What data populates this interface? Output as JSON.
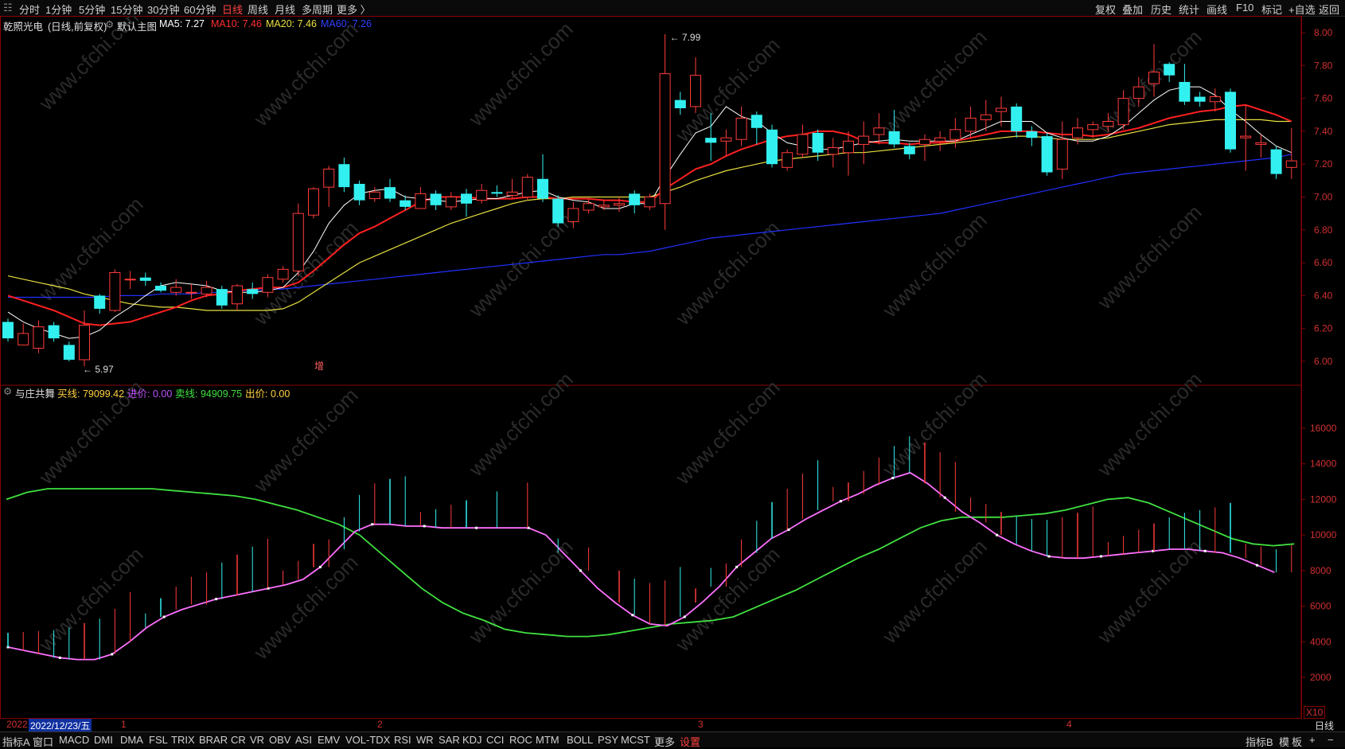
{
  "topbar": {
    "left_icon": "menu-icon",
    "periods": [
      "分时",
      "1分钟",
      "5分钟",
      "15分钟",
      "30分钟",
      "60分钟",
      "日线",
      "周线",
      "月线",
      "多周期",
      "更多 〉"
    ],
    "active_period": "日线",
    "right": [
      "复权",
      "叠加",
      "历史",
      "统计",
      "画线",
      "F10",
      "标记",
      "+自选",
      "返回"
    ]
  },
  "info": {
    "stock": "乾照光电",
    "mode": "(日线,前复权)",
    "main_label": "默认主图",
    "ma5": "MA5: 7.27",
    "ma10": "MA10: 7.46",
    "ma20": "MA20: 7.46",
    "ma60": "MA60: 7.26"
  },
  "sub_info": {
    "name": "与庄共舞",
    "buy": "买线: 79099.42",
    "in": "进价: 0.00",
    "sell": "卖线: 94909.75",
    "out": "出价: 0.00"
  },
  "annotations": {
    "high": "7.99",
    "low": "5.97",
    "marker": "增"
  },
  "price_axis": [
    "8.00",
    "7.80",
    "7.60",
    "7.40",
    "7.20",
    "7.00",
    "6.80",
    "6.60",
    "6.40",
    "6.20",
    "6.00"
  ],
  "ind_axis": [
    "16000",
    "14000",
    "12000",
    "10000",
    "8000",
    "6000",
    "4000",
    "2000"
  ],
  "ind_multiplier": "X10",
  "datebar": {
    "year": "2022",
    "cursor_date": "2022/12/23/五",
    "months": [
      "1",
      "2",
      "3",
      "4"
    ]
  },
  "bottom_tabs": [
    "指标A",
    "窗口",
    "MACD",
    "DMI",
    "DMA",
    "FSL",
    "TRIX",
    "BRAR",
    "CR",
    "VR",
    "OBV",
    "ASI",
    "EMV",
    "VOL-TDX",
    "RSI",
    "WR",
    "SAR",
    "KDJ",
    "CCI",
    "ROC",
    "MTM",
    "BOLL",
    "PSY",
    "MCST",
    "更多",
    "设置"
  ],
  "bottom_right": [
    "指标B",
    "模",
    "板",
    "+",
    "−"
  ],
  "period_right": "日线",
  "watermark": "www.cfchi.com",
  "colors": {
    "up": "#ff3b3b",
    "down": "#33f0f0",
    "ma5": "#ffffff",
    "ma10": "#ff2020",
    "ma20": "#e8e040",
    "ma60": "#2030ff",
    "buyline": "#ff70ff",
    "sellline": "#40e040",
    "grid": "#8a0000"
  },
  "chart_data": {
    "type": "candlestick",
    "price_range": [
      5.9,
      8.05
    ],
    "indicator_range": [
      0,
      17500
    ],
    "candles": [
      [
        6.24,
        6.14,
        6.26,
        6.12
      ],
      [
        6.1,
        6.17,
        6.23,
        6.1
      ],
      [
        6.08,
        6.21,
        6.25,
        6.05
      ],
      [
        6.22,
        6.14,
        6.24,
        6.12
      ],
      [
        6.1,
        6.01,
        6.12,
        6.0
      ],
      [
        6.01,
        6.22,
        6.31,
        5.97
      ],
      [
        6.4,
        6.32,
        6.41,
        6.29
      ],
      [
        6.31,
        6.54,
        6.56,
        6.3
      ],
      [
        6.5,
        6.5,
        6.55,
        6.44
      ],
      [
        6.51,
        6.49,
        6.54,
        6.46
      ],
      [
        6.46,
        6.43,
        6.48,
        6.42
      ],
      [
        6.42,
        6.45,
        6.5,
        6.4
      ],
      [
        6.42,
        6.42,
        6.47,
        6.38
      ],
      [
        6.41,
        6.45,
        6.49,
        6.39
      ],
      [
        6.44,
        6.34,
        6.46,
        6.32
      ],
      [
        6.35,
        6.46,
        6.47,
        6.31
      ],
      [
        6.44,
        6.41,
        6.48,
        6.38
      ],
      [
        6.42,
        6.51,
        6.53,
        6.39
      ],
      [
        6.5,
        6.56,
        6.58,
        6.48
      ],
      [
        6.55,
        6.9,
        6.96,
        6.52
      ],
      [
        6.89,
        7.05,
        7.06,
        6.87
      ],
      [
        7.06,
        7.17,
        7.19,
        6.94
      ],
      [
        7.2,
        7.06,
        7.24,
        7.03
      ],
      [
        7.08,
        6.98,
        7.1,
        6.95
      ],
      [
        6.99,
        7.03,
        7.06,
        6.97
      ],
      [
        7.06,
        6.99,
        7.11,
        6.97
      ],
      [
        6.98,
        6.94,
        7.01,
        6.92
      ],
      [
        6.93,
        7.02,
        7.06,
        6.93
      ],
      [
        7.02,
        6.95,
        7.04,
        6.92
      ],
      [
        6.94,
        7.0,
        7.03,
        6.92
      ],
      [
        7.02,
        6.96,
        7.05,
        6.88
      ],
      [
        6.98,
        7.04,
        7.08,
        6.96
      ],
      [
        7.03,
        7.02,
        7.07,
        7.0
      ],
      [
        7.01,
        7.03,
        7.11,
        6.99
      ],
      [
        7.0,
        7.12,
        7.14,
        6.98
      ],
      [
        7.11,
        6.99,
        7.26,
        6.97
      ],
      [
        6.99,
        6.84,
        7.01,
        6.82
      ],
      [
        6.85,
        6.93,
        6.97,
        6.81
      ],
      [
        6.92,
        6.96,
        6.99,
        6.9
      ],
      [
        6.94,
        6.95,
        6.98,
        6.92
      ],
      [
        6.95,
        6.96,
        7.0,
        6.91
      ],
      [
        7.02,
        6.95,
        7.04,
        6.9
      ],
      [
        6.94,
        7.0,
        7.02,
        6.92
      ],
      [
        6.96,
        7.75,
        7.99,
        6.8
      ],
      [
        7.59,
        7.54,
        7.64,
        7.5
      ],
      [
        7.55,
        7.74,
        7.85,
        7.51
      ],
      [
        7.36,
        7.33,
        7.51,
        7.22
      ],
      [
        7.34,
        7.36,
        7.41,
        7.25
      ],
      [
        7.35,
        7.48,
        7.55,
        7.31
      ],
      [
        7.5,
        7.42,
        7.52,
        7.32
      ],
      [
        7.41,
        7.2,
        7.44,
        7.18
      ],
      [
        7.18,
        7.27,
        7.29,
        7.16
      ],
      [
        7.26,
        7.38,
        7.44,
        7.24
      ],
      [
        7.39,
        7.27,
        7.41,
        7.22
      ],
      [
        7.26,
        7.3,
        7.36,
        7.18
      ],
      [
        7.27,
        7.34,
        7.4,
        7.13
      ],
      [
        7.32,
        7.37,
        7.46,
        7.2
      ],
      [
        7.38,
        7.42,
        7.51,
        7.32
      ],
      [
        7.4,
        7.32,
        7.53,
        7.3
      ],
      [
        7.31,
        7.26,
        7.33,
        7.23
      ],
      [
        7.32,
        7.35,
        7.38,
        7.22
      ],
      [
        7.34,
        7.36,
        7.4,
        7.28
      ],
      [
        7.35,
        7.41,
        7.48,
        7.3
      ],
      [
        7.4,
        7.48,
        7.55,
        7.36
      ],
      [
        7.47,
        7.5,
        7.59,
        7.4
      ],
      [
        7.52,
        7.54,
        7.61,
        7.43
      ],
      [
        7.55,
        7.4,
        7.57,
        7.36
      ],
      [
        7.4,
        7.36,
        7.43,
        7.31
      ],
      [
        7.37,
        7.15,
        7.39,
        7.13
      ],
      [
        7.17,
        7.35,
        7.46,
        7.11
      ],
      [
        7.36,
        7.42,
        7.48,
        7.32
      ],
      [
        7.41,
        7.44,
        7.46,
        7.36
      ],
      [
        7.43,
        7.46,
        7.51,
        7.4
      ],
      [
        7.44,
        7.6,
        7.65,
        7.41
      ],
      [
        7.6,
        7.67,
        7.73,
        7.55
      ],
      [
        7.69,
        7.76,
        7.93,
        7.61
      ],
      [
        7.81,
        7.74,
        7.82,
        7.7
      ],
      [
        7.7,
        7.58,
        7.81,
        7.56
      ],
      [
        7.61,
        7.58,
        7.64,
        7.55
      ],
      [
        7.58,
        7.61,
        7.66,
        7.52
      ],
      [
        7.64,
        7.29,
        7.66,
        7.27
      ],
      [
        7.36,
        7.37,
        7.56,
        7.16
      ],
      [
        7.32,
        7.33,
        7.38,
        7.24
      ],
      [
        7.29,
        7.14,
        7.31,
        7.11
      ],
      [
        7.18,
        7.22,
        7.42,
        7.11
      ]
    ],
    "ma5": [
      6.3,
      6.24,
      6.2,
      6.17,
      6.14,
      6.15,
      6.19,
      6.27,
      6.33,
      6.4,
      6.46,
      6.48,
      6.47,
      6.46,
      6.43,
      6.42,
      6.42,
      6.43,
      6.45,
      6.54,
      6.67,
      6.84,
      6.95,
      7.02,
      7.04,
      7.05,
      7.0,
      6.99,
      6.98,
      6.97,
      6.98,
      6.99,
      6.99,
      7.01,
      7.03,
      7.04,
      7.0,
      6.98,
      6.97,
      6.93,
      6.93,
      6.96,
      6.96,
      7.12,
      7.26,
      7.39,
      7.43,
      7.55,
      7.49,
      7.46,
      7.39,
      7.33,
      7.31,
      7.29,
      7.29,
      7.31,
      7.33,
      7.34,
      7.35,
      7.34,
      7.34,
      7.34,
      7.34,
      7.38,
      7.42,
      7.46,
      7.46,
      7.46,
      7.39,
      7.36,
      7.34,
      7.34,
      7.37,
      7.43,
      7.51,
      7.59,
      7.65,
      7.67,
      7.67,
      7.62,
      7.53,
      7.46,
      7.38,
      7.31,
      7.27
    ],
    "ma10": [
      6.4,
      6.37,
      6.34,
      6.31,
      6.27,
      6.23,
      6.22,
      6.23,
      6.24,
      6.27,
      6.3,
      6.33,
      6.37,
      6.4,
      6.41,
      6.43,
      6.44,
      6.45,
      6.45,
      6.48,
      6.55,
      6.63,
      6.71,
      6.78,
      6.82,
      6.87,
      6.92,
      6.97,
      7.0,
      7.0,
      7.0,
      6.99,
      6.99,
      6.99,
      7.0,
      7.0,
      6.99,
      6.99,
      6.99,
      6.98,
      6.98,
      6.97,
      6.97,
      7.05,
      7.11,
      7.17,
      7.2,
      7.25,
      7.29,
      7.32,
      7.35,
      7.37,
      7.38,
      7.4,
      7.4,
      7.38,
      7.34,
      7.33,
      7.33,
      7.32,
      7.33,
      7.33,
      7.34,
      7.36,
      7.38,
      7.4,
      7.4,
      7.4,
      7.39,
      7.38,
      7.38,
      7.37,
      7.38,
      7.4,
      7.42,
      7.45,
      7.48,
      7.5,
      7.52,
      7.53,
      7.55,
      7.56,
      7.53,
      7.5,
      7.46
    ],
    "ma20": [
      6.52,
      6.5,
      6.48,
      6.46,
      6.44,
      6.41,
      6.39,
      6.37,
      6.35,
      6.34,
      6.33,
      6.33,
      6.32,
      6.31,
      6.31,
      6.31,
      6.31,
      6.31,
      6.32,
      6.36,
      6.42,
      6.48,
      6.54,
      6.6,
      6.64,
      6.68,
      6.72,
      6.76,
      6.8,
      6.84,
      6.87,
      6.9,
      6.93,
      6.96,
      6.98,
      6.99,
      6.99,
      7.0,
      7.0,
      7.0,
      7.0,
      7.0,
      7.0,
      7.03,
      7.06,
      7.1,
      7.13,
      7.16,
      7.18,
      7.2,
      7.22,
      7.23,
      7.24,
      7.25,
      7.26,
      7.27,
      7.27,
      7.28,
      7.29,
      7.3,
      7.31,
      7.32,
      7.33,
      7.34,
      7.35,
      7.36,
      7.37,
      7.37,
      7.36,
      7.35,
      7.35,
      7.35,
      7.36,
      7.38,
      7.4,
      7.42,
      7.44,
      7.45,
      7.46,
      7.47,
      7.47,
      7.47,
      7.47,
      7.46,
      7.46
    ],
    "ma60": [
      6.39,
      6.39,
      6.39,
      6.39,
      6.39,
      6.39,
      6.39,
      6.4,
      6.4,
      6.4,
      6.41,
      6.41,
      6.41,
      6.42,
      6.42,
      6.43,
      6.43,
      6.44,
      6.44,
      6.45,
      6.46,
      6.47,
      6.48,
      6.49,
      6.5,
      6.51,
      6.52,
      6.53,
      6.54,
      6.55,
      6.56,
      6.57,
      6.58,
      6.59,
      6.6,
      6.61,
      6.62,
      6.63,
      6.64,
      6.65,
      6.65,
      6.66,
      6.67,
      6.69,
      6.71,
      6.73,
      6.75,
      6.76,
      6.77,
      6.78,
      6.79,
      6.8,
      6.81,
      6.82,
      6.83,
      6.84,
      6.85,
      6.86,
      6.87,
      6.88,
      6.89,
      6.9,
      6.92,
      6.94,
      6.96,
      6.98,
      7.0,
      7.02,
      7.04,
      7.06,
      7.08,
      7.1,
      7.12,
      7.14,
      7.15,
      7.16,
      7.17,
      7.18,
      7.19,
      7.2,
      7.21,
      7.22,
      7.23,
      7.24,
      7.26
    ],
    "sell_line": [
      12000,
      12400,
      12600,
      12600,
      12600,
      12600,
      12600,
      12600,
      12500,
      12400,
      12300,
      12200,
      12000,
      11700,
      11400,
      11000,
      10600,
      10000,
      9000,
      8000,
      7000,
      6200,
      5600,
      5200,
      4700,
      4500,
      4400,
      4300,
      4300,
      4400,
      4600,
      4800,
      5000,
      5100,
      5200,
      5400,
      5900,
      6400,
      6900,
      7500,
      8100,
      8700,
      9200,
      9800,
      10400,
      10800,
      11000,
      11000,
      11000,
      11100,
      11200,
      11400,
      11700,
      12000,
      12100,
      11800,
      11300,
      10800,
      10300,
      9800,
      9500,
      9400,
      9500
    ],
    "buy_line": [
      3700,
      3500,
      3300,
      3100,
      3000,
      3000,
      3300,
      4000,
      4800,
      5400,
      5800,
      6100,
      6400,
      6600,
      6800,
      7000,
      7200,
      7500,
      8200,
      9200,
      10200,
      10600,
      10600,
      10500,
      10500,
      10400,
      10400,
      10400,
      10400,
      10400,
      10400,
      10000,
      9000,
      8000,
      7000,
      6200,
      5500,
      5000,
      4900,
      5400,
      6200,
      7100,
      8200,
      9000,
      9800,
      10300,
      10900,
      11400,
      11900,
      12300,
      12800,
      13200,
      13500,
      12900,
      12100,
      11300,
      10700,
      10000,
      9500,
      9100,
      8800,
      8700,
      8700,
      8800,
      8900,
      9000,
      9100,
      9200,
      9200,
      9100,
      9000,
      8700,
      8300,
      7900
    ]
  }
}
